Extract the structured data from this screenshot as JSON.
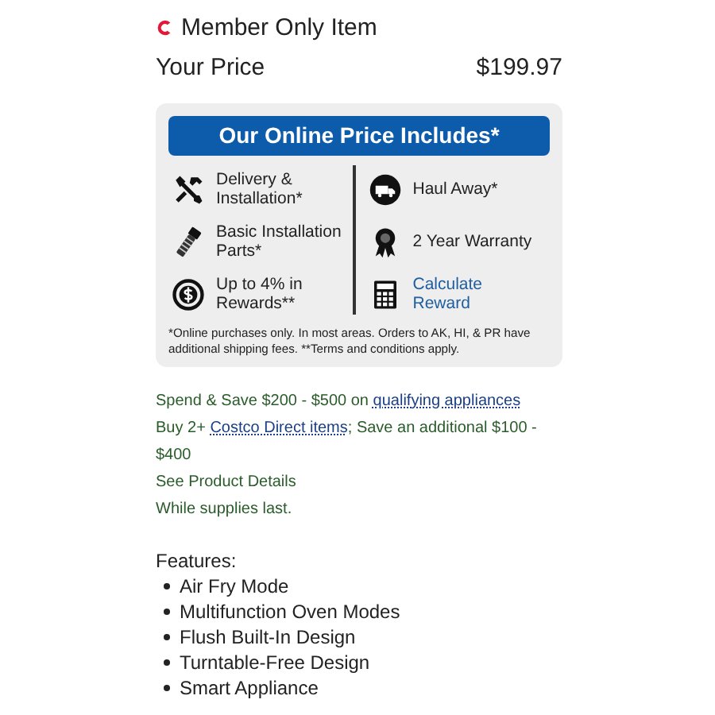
{
  "member": {
    "label": "Member Only Item"
  },
  "price": {
    "label": "Your Price",
    "value": "$199.97"
  },
  "includes": {
    "title": "Our Online Price Includes*",
    "left": [
      {
        "text": "Delivery & Installation*",
        "kind": "text"
      },
      {
        "text": "Basic Installation Parts*",
        "kind": "text"
      },
      {
        "text": "Up to 4% in Rewards**",
        "kind": "text"
      }
    ],
    "right": [
      {
        "text": "Haul Away*",
        "kind": "text"
      },
      {
        "text": "2 Year Warranty",
        "kind": "text"
      },
      {
        "text": "Calculate Reward",
        "kind": "link"
      }
    ],
    "note": "*Online purchases only. In most areas. Orders to AK, HI, & PR have additional shipping fees. **Terms and conditions apply."
  },
  "promotions": [
    [
      {
        "kind": "text",
        "text": "Spend & Save $200 - $500 on "
      },
      {
        "kind": "link",
        "text": "qualifying appliances"
      }
    ],
    [
      {
        "kind": "text",
        "text": "Buy 2+ "
      },
      {
        "kind": "link",
        "text": "Costco Direct items"
      },
      {
        "kind": "text",
        "text": "; Save an additional $100 - $400"
      }
    ],
    [
      {
        "kind": "text",
        "text": "See Product Details"
      }
    ],
    [
      {
        "kind": "text",
        "text": "While supplies last."
      }
    ]
  ],
  "features": {
    "title": "Features:",
    "items": [
      "Air Fry Mode",
      "Multifunction Oven Modes",
      "Flush Built-In Design",
      "Turntable-Free Design",
      "Smart Appliance"
    ]
  }
}
